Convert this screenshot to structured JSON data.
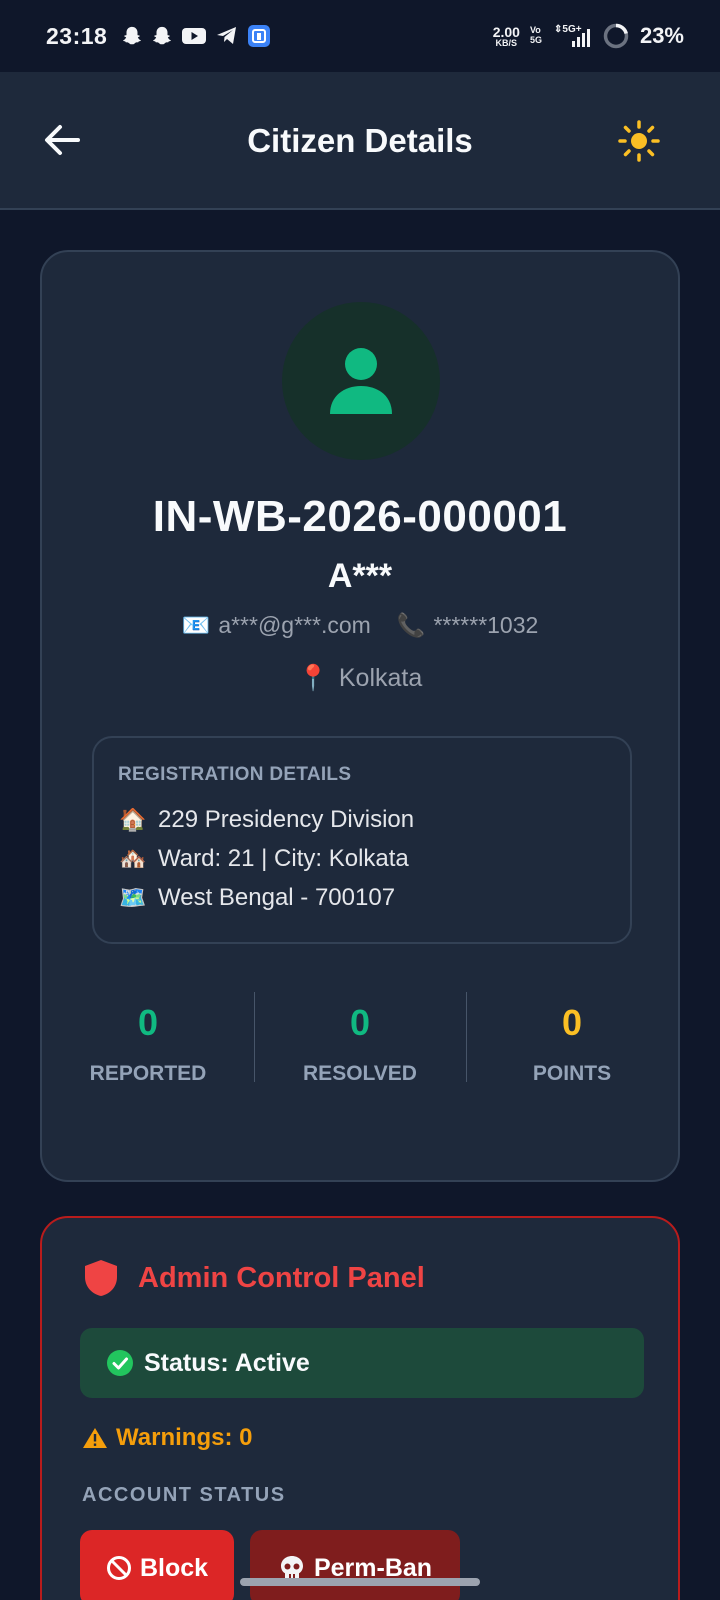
{
  "status_bar": {
    "time": "23:18",
    "net_speed_value": "2.00",
    "net_speed_unit": "KB/S",
    "volte_top": "Vo",
    "volte_bottom": "5G",
    "network": "5G",
    "battery": "23%",
    "notification_icons": [
      "snapchat-icon",
      "snapchat-icon",
      "youtube-icon",
      "telegram-icon",
      "app-icon"
    ]
  },
  "header": {
    "title": "Citizen Details",
    "back_icon": "arrow-left-icon",
    "theme_icon": "sun-icon"
  },
  "profile": {
    "citizen_id": "IN-WB-2026-000001",
    "name": "A***",
    "email": "a***@g***.com",
    "phone": "******1032",
    "city": "Kolkata",
    "email_emoji": "📧",
    "phone_emoji": "📞",
    "location_emoji": "📍"
  },
  "registration": {
    "title": "REGISTRATION DETAILS",
    "lines": [
      {
        "emoji": "🏠",
        "text": "229  Presidency Division"
      },
      {
        "emoji": "🏘️",
        "text": "Ward: 21 | City: Kolkata"
      },
      {
        "emoji": "🗺️",
        "text": "West Bengal - 700107"
      }
    ]
  },
  "stats": [
    {
      "value": "0",
      "label": "REPORTED",
      "color": "#10b981"
    },
    {
      "value": "0",
      "label": "RESOLVED",
      "color": "#10b981"
    },
    {
      "value": "0",
      "label": "POINTS",
      "color": "#fbbf24"
    }
  ],
  "admin": {
    "title": "Admin Control Panel",
    "status": "Status: Active",
    "warnings": "Warnings: 0",
    "account_status_label": "ACCOUNT STATUS",
    "block_label": "Block",
    "ban_label": "Perm-Ban"
  },
  "colors": {
    "accent_green": "#10b981",
    "accent_red": "#ef4444",
    "accent_amber": "#f59e0b"
  }
}
